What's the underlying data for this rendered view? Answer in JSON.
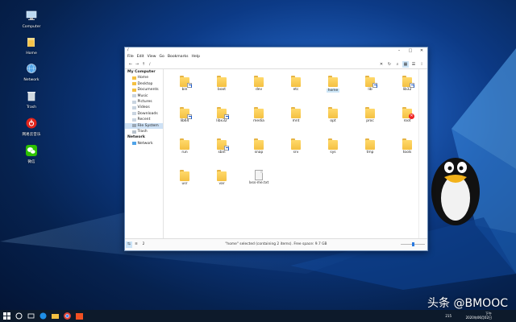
{
  "desktop": {
    "icons": [
      {
        "label": "Computer"
      },
      {
        "label": "Home"
      },
      {
        "label": "Network"
      },
      {
        "label": "Trash"
      },
      {
        "label": "网易云音乐"
      },
      {
        "label": "微信"
      }
    ]
  },
  "window": {
    "title": "/",
    "buttons": {
      "minimize": "–",
      "maximize": "□",
      "close": "✕"
    }
  },
  "menubar": [
    "File",
    "Edit",
    "View",
    "Go",
    "Bookmarks",
    "Help"
  ],
  "toolbar": {
    "back": "←",
    "forward": "→",
    "up": "↑",
    "location": "/"
  },
  "sidebar": {
    "my_computer": "My Computer",
    "places": [
      "Home",
      "Desktop",
      "Documents",
      "Music",
      "Pictures",
      "Videos",
      "Downloads",
      "Recent",
      "File System",
      "Trash"
    ],
    "network_head": "Network",
    "network_items": [
      "Network"
    ]
  },
  "items": [
    {
      "name": "bin",
      "type": "folder",
      "link": true
    },
    {
      "name": "boot",
      "type": "folder"
    },
    {
      "name": "dev",
      "type": "folder"
    },
    {
      "name": "etc",
      "type": "folder"
    },
    {
      "name": "home",
      "type": "folder",
      "selected": true
    },
    {
      "name": "lib",
      "type": "folder",
      "link": true
    },
    {
      "name": "lib32",
      "type": "folder",
      "link": true
    },
    {
      "name": "lib64",
      "type": "folder",
      "link": true
    },
    {
      "name": "libx32",
      "type": "folder",
      "link": true
    },
    {
      "name": "media",
      "type": "folder"
    },
    {
      "name": "mnt",
      "type": "folder"
    },
    {
      "name": "opt",
      "type": "folder"
    },
    {
      "name": "proc",
      "type": "folder"
    },
    {
      "name": "root",
      "type": "folder",
      "denied": true
    },
    {
      "name": "run",
      "type": "folder"
    },
    {
      "name": "sbin",
      "type": "folder",
      "link": true
    },
    {
      "name": "snap",
      "type": "folder"
    },
    {
      "name": "srv",
      "type": "folder"
    },
    {
      "name": "sys",
      "type": "folder"
    },
    {
      "name": "tmp",
      "type": "folder"
    },
    {
      "name": "tools",
      "type": "folder"
    },
    {
      "name": "usr",
      "type": "folder"
    },
    {
      "name": "var",
      "type": "folder"
    },
    {
      "name": "lxss-me.txt",
      "type": "file"
    }
  ],
  "status": {
    "message": "\"home\" selected (containing 2 items). Free space: 9.7 GB",
    "buttons": [
      "⇆",
      "≡",
      "2"
    ],
    "zoom_level": 0.5
  },
  "taskbar": {
    "clock_time": "下午",
    "clock_date": "2020年06月02日",
    "tray_text": "215"
  },
  "watermark": "头条 @BMOOC",
  "colors": {
    "folder": "#f4c042",
    "selection": "#cde6f7",
    "accent": "#2a7ae0"
  }
}
